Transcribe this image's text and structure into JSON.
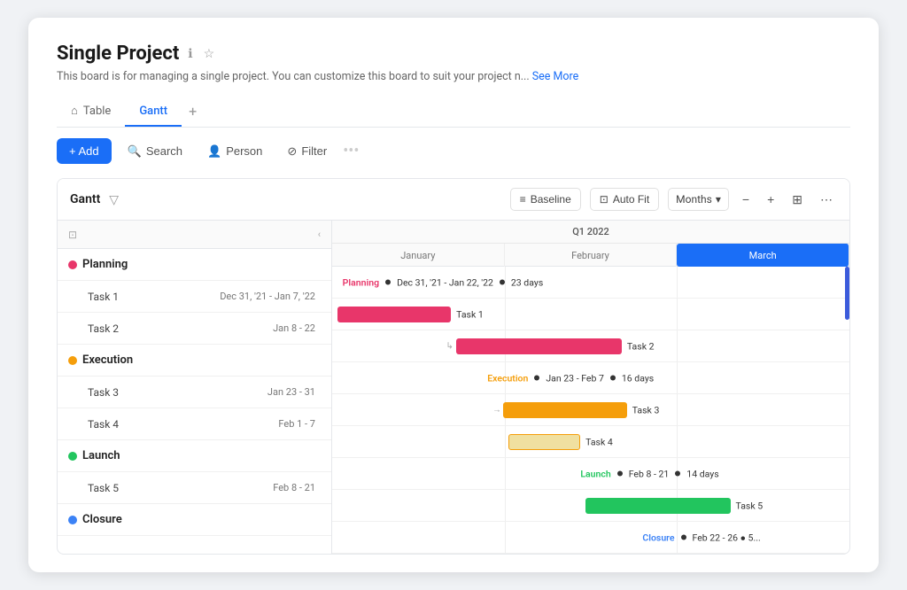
{
  "page": {
    "title": "Single Project",
    "description": "This board is for managing a single project. You can customize this board to suit your project n...",
    "see_more": "See More"
  },
  "tabs": [
    {
      "id": "table",
      "label": "Table",
      "active": false
    },
    {
      "id": "gantt",
      "label": "Gantt",
      "active": true
    }
  ],
  "toolbar": {
    "add_label": "+ Add",
    "search_label": "Search",
    "person_label": "Person",
    "filter_label": "Filter",
    "more_label": "..."
  },
  "gantt": {
    "title": "Gantt",
    "baseline_label": "Baseline",
    "autofit_label": "Auto Fit",
    "months_label": "Months",
    "quarter": "Q1 2022",
    "months": [
      "January",
      "February",
      "March"
    ],
    "controls": {
      "minus": "−",
      "plus": "+",
      "export": "⬜",
      "more": "⋯"
    }
  },
  "groups": [
    {
      "name": "Planning",
      "color": "#e8366a",
      "milestone": "Planning ● Dec 31, '21 - Jan 22, '22 ● 23 days",
      "tasks": [
        {
          "name": "Task 1",
          "date": "Dec 31, '21 - Jan 7, '22"
        },
        {
          "name": "Task 2",
          "date": "Jan 8 - 22"
        }
      ]
    },
    {
      "name": "Execution",
      "color": "#f59e0b",
      "milestone": "Execution ● Jan 23 - Feb 7 ● 16 days",
      "tasks": [
        {
          "name": "Task 3",
          "date": "Jan 23 - 31"
        },
        {
          "name": "Task 4",
          "date": "Feb 1 - 7"
        }
      ]
    },
    {
      "name": "Launch",
      "color": "#22c55e",
      "milestone": "Launch ● Feb 8 - 21 ● 14 days",
      "tasks": [
        {
          "name": "Task 5",
          "date": "Feb 8 - 21"
        }
      ]
    },
    {
      "name": "Closure",
      "color": "#3b82f6",
      "milestone": "Closure ● Feb 22 - 26 ● 5...",
      "tasks": []
    }
  ]
}
